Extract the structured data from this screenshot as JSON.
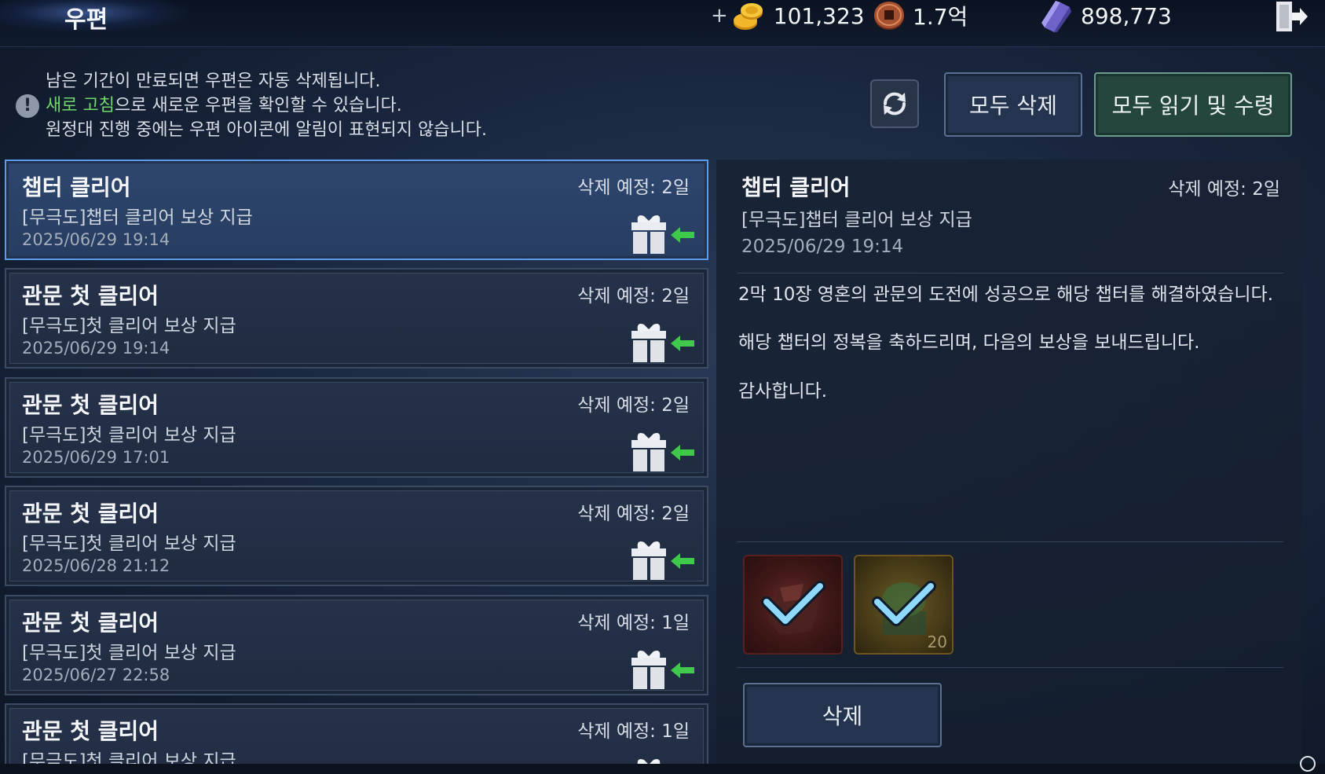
{
  "header": {
    "title": "우편",
    "gold": {
      "icon": "gold-coins-icon",
      "plus": "+",
      "value": "101,323"
    },
    "coin": {
      "icon": "bronze-coin-icon",
      "value": "1.7억"
    },
    "crystal": {
      "icon": "purple-crystal-icon",
      "value": "898,773"
    }
  },
  "notice": {
    "line1": "남은 기간이 만료되면 우편은 자동 삭제됩니다.",
    "line2_highlight": "새로 고침",
    "line2_rest": "으로 새로운 우편을 확인할 수 있습니다.",
    "line3": "원정대 진행 중에는 우편 아이콘에 알림이 표현되지 않습니다.",
    "icon": "!"
  },
  "actions": {
    "delete_all": "모두 삭제",
    "read_all": "모두 읽기 및 수령"
  },
  "mails": [
    {
      "title": "챕터 클리어",
      "subtitle": "[무극도]챕터 클리어 보상 지급",
      "date": "2025/06/29 19:14",
      "expire": "삭제 예정: 2일"
    },
    {
      "title": "관문 첫 클리어",
      "subtitle": "[무극도]첫 클리어 보상 지급",
      "date": "2025/06/29 19:14",
      "expire": "삭제 예정: 2일"
    },
    {
      "title": "관문 첫 클리어",
      "subtitle": "[무극도]첫 클리어 보상 지급",
      "date": "2025/06/29 17:01",
      "expire": "삭제 예정: 2일"
    },
    {
      "title": "관문 첫 클리어",
      "subtitle": "[무극도]첫 클리어 보상 지급",
      "date": "2025/06/28 21:12",
      "expire": "삭제 예정: 2일"
    },
    {
      "title": "관문 첫 클리어",
      "subtitle": "[무극도]첫 클리어 보상 지급",
      "date": "2025/06/27 22:58",
      "expire": "삭제 예정: 1일"
    },
    {
      "title": "관문 첫 클리어",
      "subtitle": "[무극도]첫 클리어 보상 지급",
      "date": "",
      "expire": "삭제 예정: 1일"
    }
  ],
  "detail": {
    "title": "챕터 클리어",
    "expire": "삭제 예정: 2일",
    "subtitle": "[무극도]챕터 클리어 보상 지급",
    "date": "2025/06/29 19:14",
    "body": [
      "2막 10장 영혼의 관문의 도전에 성공으로 해당 챕터를 해결하였습니다.",
      "해당 챕터의 정복을 축하드리며, 다음의 보상을 보내드립니다.",
      "감사합니다."
    ],
    "rewards": [
      {
        "icon": "red-ore-reward-icon",
        "claimed": true,
        "count": ""
      },
      {
        "icon": "jade-seal-reward-icon",
        "claimed": true,
        "count": "20"
      }
    ],
    "delete_button": "삭제"
  }
}
